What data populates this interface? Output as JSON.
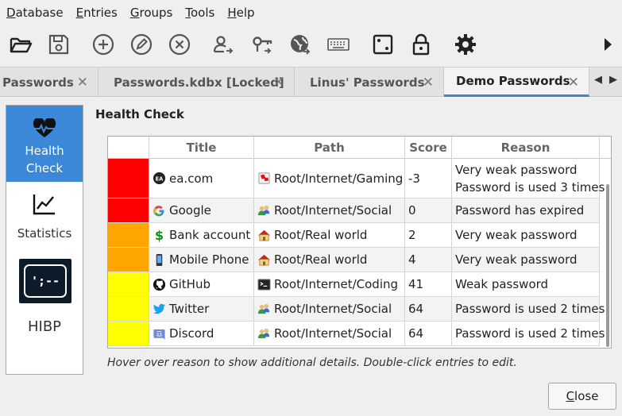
{
  "menubar": {
    "items": [
      {
        "key": "D",
        "rest": "atabase"
      },
      {
        "key": "E",
        "rest": "ntries"
      },
      {
        "key": "G",
        "rest": "roups"
      },
      {
        "key": "T",
        "rest": "ools"
      },
      {
        "key": "H",
        "rest": "elp"
      }
    ]
  },
  "toolbar": {
    "icons": [
      "open-database-icon",
      "save-database-icon",
      "add-entry-icon",
      "edit-entry-icon",
      "delete-entry-icon",
      "copy-username-icon",
      "copy-password-icon",
      "copy-url-icon",
      "autotype-icon",
      "password-generator-icon",
      "lock-database-icon",
      "settings-icon",
      "toolbar-overflow-icon"
    ]
  },
  "tabs": [
    {
      "label": "Passwords",
      "close": "✕"
    },
    {
      "label": "Passwords.kdbx [Locked]",
      "close": "✕"
    },
    {
      "label": "Linus' Passwords",
      "close": "✕"
    },
    {
      "label": "Demo Passwords",
      "close": "✕",
      "active": true
    }
  ],
  "tab_scroll": {
    "left": "◀",
    "right": "▶"
  },
  "sidebar": {
    "items": [
      {
        "label_lines": [
          "Health",
          "Check"
        ],
        "active": true,
        "icon": "heartbeat-icon"
      },
      {
        "label_lines": [
          "Statistics"
        ],
        "active": false,
        "icon": "chart-line-icon"
      },
      {
        "label_lines": [
          "HIBP"
        ],
        "active": false,
        "icon": "hibp-logo"
      }
    ],
    "hibp_logo_text": "';--"
  },
  "heading": "Health Check",
  "table": {
    "columns": [
      "",
      "Title",
      "Path",
      "Score",
      "Reason"
    ],
    "rows": [
      {
        "color": "#ff0000",
        "icon": "ea-icon",
        "title": "ea.com",
        "path_icon": "gaming-folder-icon",
        "path": "Root/Internet/Gaming",
        "score": "-3",
        "reason": [
          "Very weak password",
          "Password is used 3 times"
        ]
      },
      {
        "color": "#ff0000",
        "icon": "google-icon",
        "title": "Google",
        "path_icon": "social-folder-icon",
        "path": "Root/Internet/Social",
        "score": "0",
        "reason": [
          "Password has expired"
        ]
      },
      {
        "color": "#ffa500",
        "icon": "dollar-icon",
        "title": "Bank account",
        "path_icon": "house-folder-icon",
        "path": "Root/Real world",
        "score": "2",
        "reason": [
          "Very weak password"
        ]
      },
      {
        "color": "#ffa500",
        "icon": "phone-icon",
        "title": "Mobile Phone",
        "path_icon": "house-folder-icon",
        "path": "Root/Real world",
        "score": "4",
        "reason": [
          "Very weak password"
        ]
      },
      {
        "color": "#ffff00",
        "icon": "github-icon",
        "title": "GitHub",
        "path_icon": "terminal-folder-icon",
        "path": "Root/Internet/Coding",
        "score": "41",
        "reason": [
          "Weak password"
        ]
      },
      {
        "color": "#ffff00",
        "icon": "twitter-icon",
        "title": "Twitter",
        "path_icon": "social-folder-icon",
        "path": "Root/Internet/Social",
        "score": "64",
        "reason": [
          "Password is used 2 times"
        ]
      },
      {
        "color": "#ffff00",
        "icon": "discord-icon",
        "title": "Discord",
        "path_icon": "social-folder-icon",
        "path": "Root/Internet/Social",
        "score": "64",
        "reason": [
          "Password is used 2 times"
        ]
      }
    ]
  },
  "hint": "Hover over reason to show additional details. Double-click entries to edit.",
  "close_button": {
    "key": "C",
    "rest": "lose"
  }
}
